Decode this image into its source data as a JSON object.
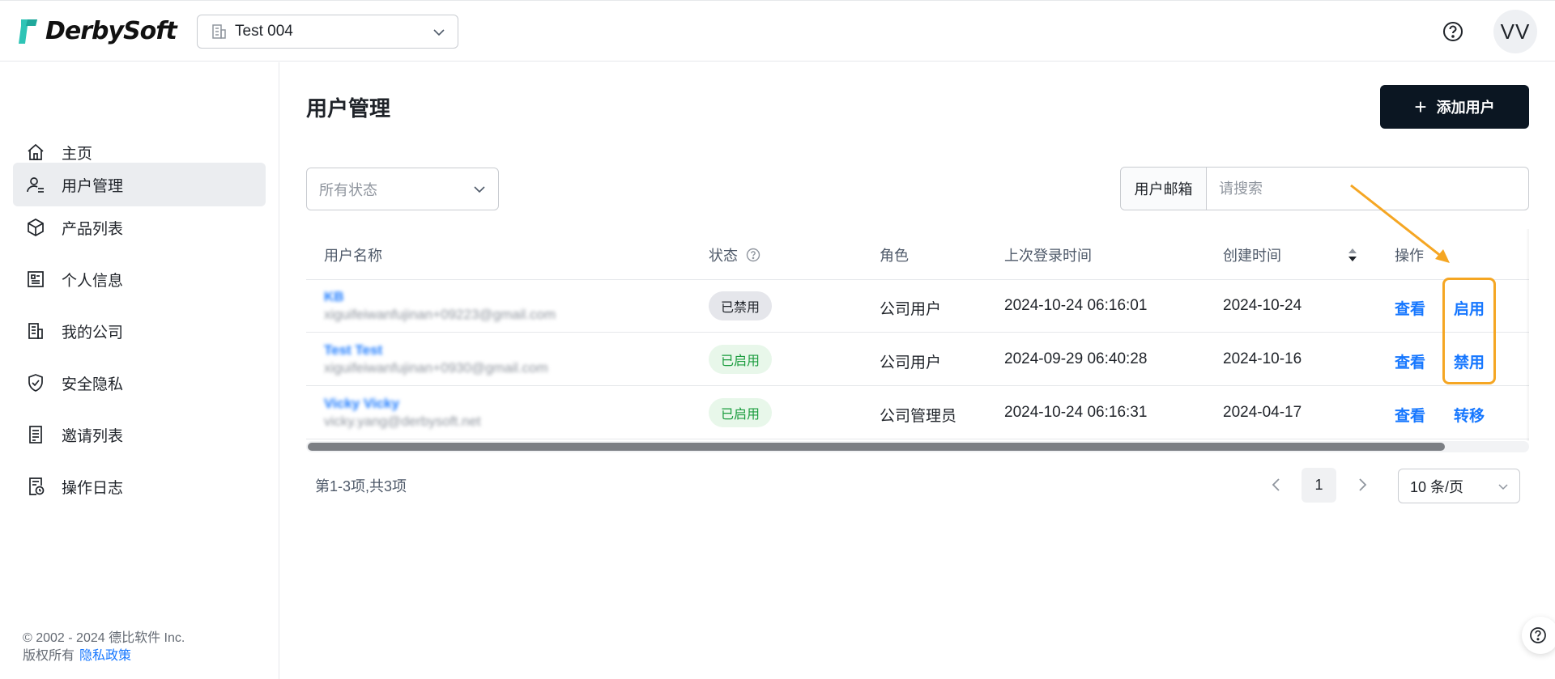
{
  "header": {
    "brand": "DerbySoft",
    "company_select": "Test 004",
    "avatar_initials": "VV"
  },
  "sidebar": {
    "items": [
      {
        "label": "主页",
        "icon": "home-icon"
      },
      {
        "label": "用户管理",
        "icon": "user-manage-icon",
        "active": true
      },
      {
        "label": "产品列表",
        "icon": "cube-icon"
      },
      {
        "label": "个人信息",
        "icon": "profile-card-icon"
      },
      {
        "label": "我的公司",
        "icon": "building-icon"
      },
      {
        "label": "安全隐私",
        "icon": "shield-check-icon"
      },
      {
        "label": "邀请列表",
        "icon": "document-list-icon"
      },
      {
        "label": "操作日志",
        "icon": "log-clock-icon"
      }
    ],
    "footer_copyright": "© 2002 - 2024 德比软件 Inc.",
    "footer_rights": "版权所有",
    "footer_privacy_link": "隐私政策"
  },
  "main": {
    "title": "用户管理",
    "add_user_label": "添加用户",
    "status_filter_placeholder": "所有状态",
    "search_field_label": "用户邮箱",
    "search_placeholder": "请搜索"
  },
  "table": {
    "columns": [
      "用户名称",
      "状态",
      "角色",
      "上次登录时间",
      "创建时间",
      "操作"
    ],
    "rows": [
      {
        "name": "KB",
        "email": "xiguifeiwanfujinan+09223@gmail.com",
        "status": "已禁用",
        "status_type": "disabled",
        "role": "公司用户",
        "last_login": "2024-10-24 06:16:01",
        "created": "2024-10-24",
        "action_view": "查看",
        "action_other": "启用"
      },
      {
        "name": "Test Test",
        "email": "xiguifeiwanfujinan+0930@gmail.com",
        "status": "已启用",
        "status_type": "enabled",
        "role": "公司用户",
        "last_login": "2024-09-29 06:40:28",
        "created": "2024-10-16",
        "action_view": "查看",
        "action_other": "禁用"
      },
      {
        "name": "Vicky Vicky",
        "email": "vicky.yang@derbysoft.net",
        "status": "已启用",
        "status_type": "enabled",
        "role": "公司管理员",
        "last_login": "2024-10-24 06:16:31",
        "created": "2024-04-17",
        "action_view": "查看",
        "action_other": "转移"
      }
    ]
  },
  "pagination": {
    "total_text": "第1-3项,共3项",
    "current_page": "1",
    "page_size": "10 条/页"
  },
  "colors": {
    "accent": "#1677ff",
    "primary_button": "#0b1622",
    "annotation": "#f5a623",
    "enabled_text": "#1a9c3e",
    "enabled_bg": "#e8f7ea",
    "disabled_bg": "#e5e6eb"
  }
}
